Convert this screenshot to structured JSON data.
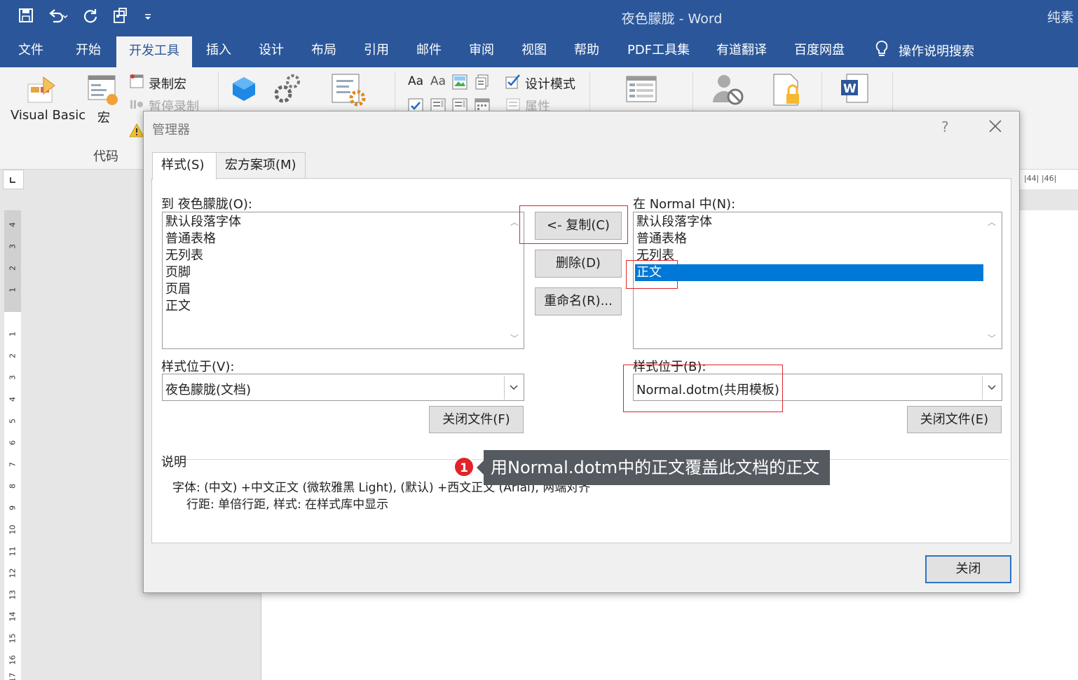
{
  "window": {
    "title": "夜色朦胧 - Word",
    "user": "纯素"
  },
  "menu": {
    "tabs": [
      "文件",
      "开始",
      "开发工具",
      "插入",
      "设计",
      "布局",
      "引用",
      "邮件",
      "审阅",
      "视图",
      "帮助",
      "PDF工具集",
      "有道翻译",
      "百度网盘"
    ],
    "active": "开发工具",
    "tell_me": "操作说明搜索"
  },
  "ribbon": {
    "visual_basic": "Visual Basic",
    "macros": "宏",
    "record_macro": "录制宏",
    "pause_recording": "暂停录制",
    "code_group": "代码",
    "design_mode": "设计模式",
    "properties": "属性",
    "aa_1": "Aa",
    "aa_2": "Aa"
  },
  "ruler": {
    "vertical_numbers": [
      "4",
      "3",
      "2",
      "1",
      "1",
      "2",
      "3",
      "4",
      "5",
      "6",
      "7",
      "8",
      "9",
      "10",
      "11",
      "12",
      "13",
      "14",
      "15",
      "16",
      "17"
    ],
    "horizontal_right": "|44|   |46|"
  },
  "dialog": {
    "title": "管理器",
    "help": "?",
    "tabs": [
      "样式(S)",
      "宏方案项(M)"
    ],
    "left": {
      "label": "到 夜色朦胧(O):",
      "items": [
        "默认段落字体",
        "普通表格",
        "无列表",
        "页脚",
        "页眉",
        "正文"
      ],
      "location_label": "样式位于(V):",
      "location_value": "夜色朦胧(文档)",
      "close_file": "关闭文件(F)"
    },
    "right": {
      "label": "在 Normal 中(N):",
      "items": [
        "默认段落字体",
        "普通表格",
        "无列表",
        "正文"
      ],
      "selected": "正文",
      "location_label": "样式位于(B):",
      "location_value": "Normal.dotm(共用模板)",
      "close_file": "关闭文件(E)"
    },
    "buttons": {
      "copy": "<- 复制(C)",
      "delete": "删除(D)",
      "rename": "重命名(R)..."
    },
    "description": {
      "label": "说明",
      "line1": "字体: (中文) +中文正文 (微软雅黑 Light), (默认) +西文正文 (Arial), 两端对齐",
      "line2": "行距: 单倍行距, 样式: 在样式库中显示"
    },
    "close": "关闭"
  },
  "annotation": {
    "number": "1",
    "text": "用Normal.dotm中的正文覆盖此文档的正文",
    "color": "#e0242a"
  },
  "colors": {
    "accent": "#2b579a",
    "selection": "#0078d7"
  }
}
